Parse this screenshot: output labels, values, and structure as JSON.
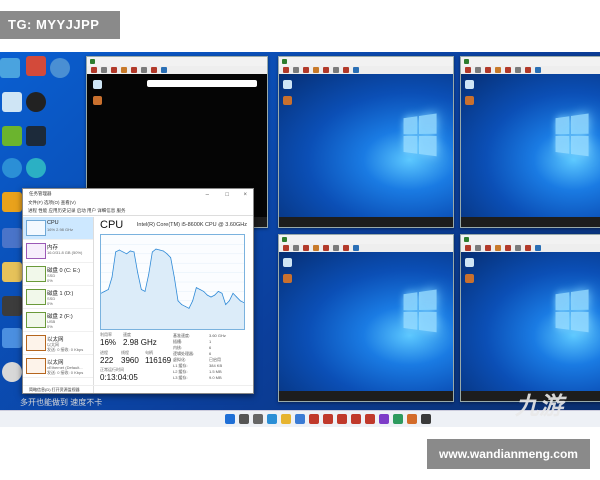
{
  "watermarks": {
    "tg": "TG: MYYJJPP",
    "url": "www.wandianmeng.com",
    "subtitle": "多开也能做到 速度不卡",
    "logo": "九游"
  },
  "vm_windows": [
    {
      "id": "vm1",
      "screen": "black"
    },
    {
      "id": "vm2",
      "screen": "win10"
    },
    {
      "id": "vm3",
      "screen": "win10"
    },
    {
      "id": "vm4",
      "screen": "win10"
    },
    {
      "id": "vm5",
      "screen": "win10"
    }
  ],
  "task_manager": {
    "title": "任务管理器",
    "menu": "文件(F)  选项(O)  查看(V)",
    "tabs": "进程  性能  应用历史记录  启动  用户  详细信息  服务",
    "sidebar": [
      {
        "name": "CPU",
        "sub": "16%  2.98 GHz",
        "kind": "cpu"
      },
      {
        "name": "内存",
        "sub": "16.0/31.8 GB (50%)",
        "kind": "mem"
      },
      {
        "name": "磁盘 0 (C: E:)",
        "sub": "SSD",
        "sub2": "0%",
        "kind": "disk"
      },
      {
        "name": "磁盘 1 (D:)",
        "sub": "SSD",
        "sub2": "0%",
        "kind": "disk"
      },
      {
        "name": "磁盘 2 (F:)",
        "sub": "USB",
        "sub2": "0%",
        "kind": "disk"
      },
      {
        "name": "以太网",
        "sub": "以太网",
        "sub2": "发送: 0 接收: 0 Kbps",
        "kind": "eth"
      },
      {
        "name": "以太网",
        "sub": "vEthernet (Default...",
        "sub2": "发送: 0 接收: 0 Kbps",
        "kind": "eth"
      }
    ],
    "cpu_label": "CPU",
    "cpu_model": "Intel(R) Core(TM) i5-8600K CPU @ 3.60GHz",
    "stats": {
      "utilization_label": "利用率",
      "utilization": "16%",
      "speed_label": "速度",
      "speed": "2.98 GHz",
      "processes_label": "进程",
      "processes": "222",
      "threads_label": "线程",
      "threads": "3960",
      "handles_label": "句柄",
      "handles": "116169",
      "uptime_label": "正常运行时间",
      "uptime": "0:13:04:05"
    },
    "details": [
      {
        "k": "基准速度:",
        "v": "3.60 GHz"
      },
      {
        "k": "插槽:",
        "v": "1"
      },
      {
        "k": "内核:",
        "v": "6"
      },
      {
        "k": "逻辑处理器:",
        "v": "6"
      },
      {
        "k": "虚拟化:",
        "v": "已启用"
      },
      {
        "k": "L1 缓存:",
        "v": "384 KB"
      },
      {
        "k": "L2 缓存:",
        "v": "1.5 MB"
      },
      {
        "k": "L3 缓存:",
        "v": "9.0 MB"
      }
    ],
    "footer": "简略信息(D)  打开资源监视器"
  },
  "chart_data": {
    "type": "area",
    "title": "CPU",
    "xlabel": "",
    "ylabel": "",
    "ylim": [
      0,
      100
    ],
    "x": [
      0,
      1,
      2,
      3,
      4,
      5,
      6,
      7,
      8,
      9,
      10,
      11,
      12,
      13,
      14,
      15,
      16,
      17,
      18,
      19,
      20,
      21,
      22,
      23,
      24,
      25,
      26,
      27,
      28,
      29,
      30,
      31,
      32,
      33,
      34,
      35,
      36,
      37,
      38,
      39
    ],
    "values": [
      38,
      40,
      42,
      55,
      82,
      84,
      82,
      80,
      83,
      82,
      60,
      42,
      40,
      58,
      82,
      85,
      84,
      83,
      80,
      76,
      55,
      30,
      26,
      24,
      22,
      30,
      44,
      42,
      40,
      36,
      34,
      36,
      40,
      38,
      26,
      30,
      38,
      34,
      30,
      28
    ]
  },
  "taskbar": {
    "icons": [
      "windows-icon",
      "search-icon",
      "taskview-icon",
      "edge-icon",
      "explorer-icon",
      "store-icon",
      "vmware-icon",
      "vmware-icon",
      "vmware-icon",
      "vmware-icon",
      "vmware-icon",
      "app-icon",
      "app-icon",
      "app-icon",
      "app-icon"
    ]
  }
}
